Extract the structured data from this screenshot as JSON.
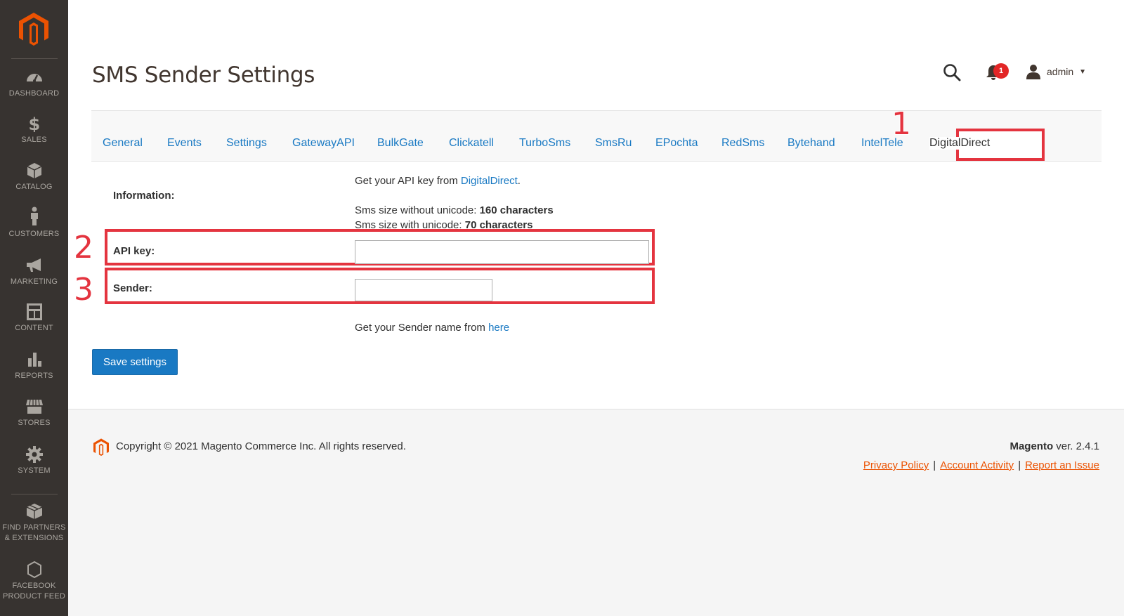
{
  "sidebar": {
    "logo": "magento-logo",
    "items": [
      {
        "label": "DASHBOARD",
        "icon": "dashboard-icon"
      },
      {
        "label": "SALES",
        "icon": "dollar-icon"
      },
      {
        "label": "CATALOG",
        "icon": "cube-icon"
      },
      {
        "label": "CUSTOMERS",
        "icon": "person-icon"
      },
      {
        "label": "MARKETING",
        "icon": "megaphone-icon"
      },
      {
        "label": "CONTENT",
        "icon": "layout-icon"
      },
      {
        "label": "REPORTS",
        "icon": "bar-chart-icon"
      },
      {
        "label": "STORES",
        "icon": "storefront-icon"
      },
      {
        "label": "SYSTEM",
        "icon": "gear-icon"
      },
      {
        "label_line1": "FIND PARTNERS",
        "label_line2": "& EXTENSIONS",
        "icon": "boxes-icon"
      },
      {
        "label_line1": "FACEBOOK",
        "label_line2": "PRODUCT FEED",
        "icon": "hexagon-icon"
      }
    ]
  },
  "header": {
    "title": "SMS Sender Settings",
    "notifications_count": "1",
    "user_name": "admin"
  },
  "tabs": [
    "General",
    "Events",
    "Settings",
    "GatewayAPI",
    "BulkGate",
    "Clickatell",
    "TurboSms",
    "SmsRu",
    "EPochta",
    "RedSms",
    "Bytehand",
    "IntelTele",
    "DigitalDirect"
  ],
  "active_tab": "DigitalDirect",
  "form": {
    "information_label": "Information:",
    "api_info_prefix": "Get your API key from ",
    "api_info_link": "DigitalDirect",
    "api_info_suffix": ".",
    "sms_no_unicode_prefix": "Sms size without unicode: ",
    "sms_no_unicode_value": "160 characters",
    "sms_unicode_prefix": "Sms size with unicode: ",
    "sms_unicode_value": "70 characters",
    "api_key_label": "API key:",
    "api_key_value": "",
    "sender_label": "Sender:",
    "sender_value": "",
    "sender_info_prefix": "Get your Sender name from ",
    "sender_info_link": "here",
    "save_label": "Save settings"
  },
  "annotations": {
    "marker_1": "1",
    "marker_2": "2",
    "marker_3": "3",
    "highlight_color": "#e4343f"
  },
  "footer": {
    "copyright": "Copyright © 2021 Magento Commerce Inc. All rights reserved.",
    "brand": "Magento",
    "version": " ver. 2.4.1",
    "link_privacy": "Privacy Policy",
    "link_account": " Account Activity",
    "link_report": "Report an Issue",
    "separator": "|"
  },
  "colors": {
    "sidebar_bg": "#373330",
    "link": "#1979c3",
    "brand_orange": "#eb5202",
    "button_bg": "#1979c3",
    "badge_red": "#e22626"
  }
}
